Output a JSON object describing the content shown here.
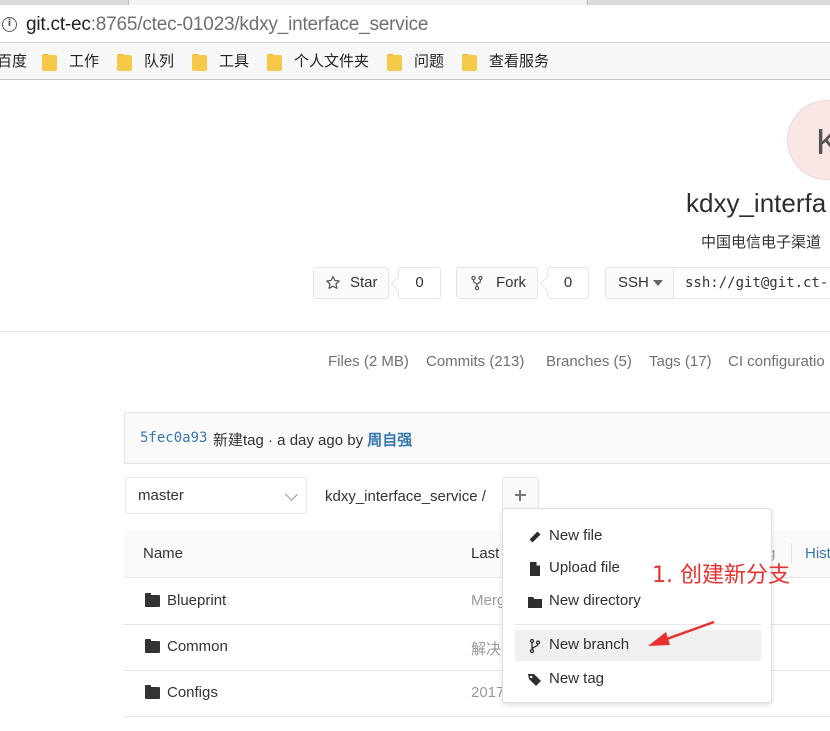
{
  "browser": {
    "url_host": "git.ct-ec",
    "url_rest": ":8765/ctec-01023/kdxy_interface_service",
    "bookmarks": [
      "百度",
      "工作",
      "队列",
      "工具",
      "个人文件夹",
      "问题",
      "查看服务"
    ]
  },
  "project": {
    "avatar_letter": "K",
    "title": "kdxy_interfa",
    "description": "中国电信电子渠道",
    "star_label": "Star",
    "star_count": "0",
    "fork_label": "Fork",
    "fork_count": "0",
    "clone_protocol": "SSH",
    "clone_url": "ssh://git@git.ct-"
  },
  "stats": {
    "files": "Files (2 MB)",
    "commits": "Commits (213)",
    "branches": "Branches (5)",
    "tags": "Tags (17)",
    "ci": "CI configuratio"
  },
  "last_commit": {
    "sha": "5fec0a93",
    "message": "新建tag · a day ago by ",
    "author": "周自强"
  },
  "toolbar": {
    "branch": "master",
    "breadcrumb": "kdxy_interface_service  /"
  },
  "table": {
    "headers": {
      "name": "Name",
      "last_commit": "Last",
      "update": "Hist"
    },
    "rows": [
      {
        "name": "Blueprint",
        "last_commit": "Merg"
      },
      {
        "name": "Common",
        "last_commit": "解决"
      },
      {
        "name": "Configs",
        "last_commit": "2017"
      }
    ]
  },
  "dropdown": {
    "items": [
      "New file",
      "Upload file",
      "New directory",
      "New branch",
      "New tag"
    ],
    "side_hint": "g"
  },
  "annotation": {
    "text": "1. 创建新分支",
    "color": "#e8312f"
  },
  "colors": {
    "link": "#3777b0",
    "border": "#e5e5e5",
    "muted": "#707070"
  }
}
